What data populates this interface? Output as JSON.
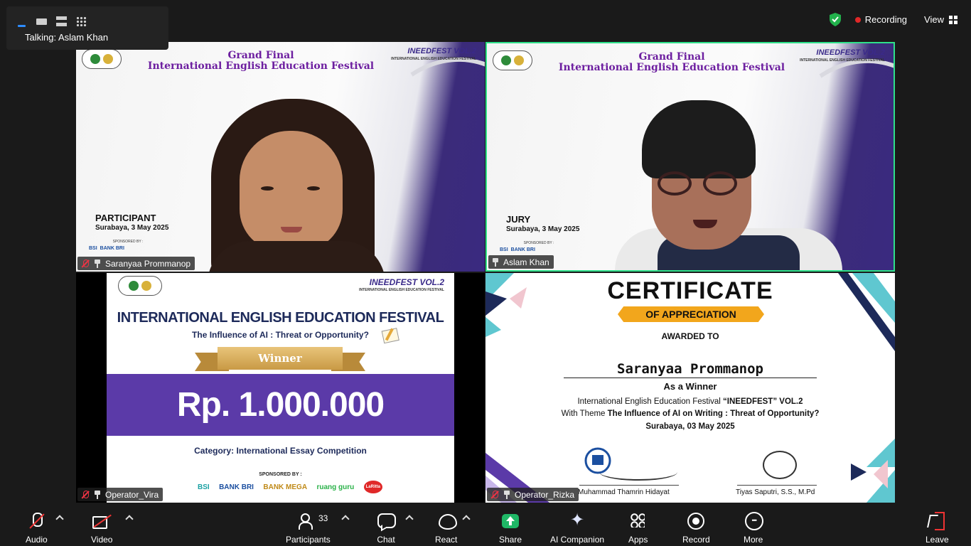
{
  "topbar": {
    "talking_label": "Talking: Aslam Khan",
    "recording_label": "Recording",
    "view_label": "View"
  },
  "tiles": [
    {
      "participant_name": "Saranyaa Prommanop",
      "title_line1": "Grand Final",
      "title_line2": "International English Education Festival",
      "event_logo": "INEEDFEST VOL.2",
      "event_logo_sub": "INTERNATIONAL ENGLISH EDUCATION FESTIVAL",
      "role": "PARTICIPANT",
      "date": "Surabaya, 3 May 2025",
      "sponsored_by": "SPONSORED BY :",
      "sponsors": [
        "BSI",
        "BANK BRI"
      ]
    },
    {
      "participant_name": "Aslam Khan",
      "title_line1": "Grand Final",
      "title_line2": "International English Education Festival",
      "event_logo": "INEEDFEST VOL.2",
      "event_logo_sub": "INTERNATIONAL ENGLISH EDUCATION FESTIVAL",
      "role": "JURY",
      "date": "Surabaya, 3 May 2025",
      "sponsored_by": "SPONSORED BY :",
      "sponsors": [
        "BSI",
        "BANK BRI"
      ]
    },
    {
      "participant_name": "Operator_Vira",
      "event_logo": "INEEDFEST VOL.2",
      "event_logo_sub": "INTERNATIONAL ENGLISH EDUCATION FESTIVAL",
      "poster_title": "INTERNATIONAL ENGLISH EDUCATION FESTIVAL",
      "poster_subtitle": "The Influence of AI : Threat or Opportunity?",
      "ribbon_label": "Winner",
      "prize_amount": "Rp. 1.000.000",
      "category": "Category: International Essay Competition",
      "sponsored_by": "SPONSORED BY :",
      "sponsors": [
        "BSI",
        "BANK BRI",
        "BANK MEGA",
        "ruang guru",
        "LaRitta"
      ]
    },
    {
      "participant_name": "Operator_Rizka",
      "cert_title": "CERTIFICATE",
      "cert_banner": "OF APPRECIATION",
      "awarded_to": "AWARDED TO",
      "recipient": "Saranyaa Prommanop",
      "as_winner": "As a Winner",
      "line1_pre": "International English Education Festival ",
      "line1_bold": "“INEEDFEST” VOL.2",
      "line2_pre": "With Theme ",
      "line2_bold": "The Influence of AI on Writing : Threat of Opportunity?",
      "date": "Surabaya, 03 May 2025",
      "signer1": "Muhammad Thamrin Hidayat",
      "signer2": "Tiyas Saputri, S.S., M.Pd"
    }
  ],
  "toolbar": {
    "audio": "Audio",
    "video": "Video",
    "participants": "Participants",
    "participants_count": "33",
    "chat": "Chat",
    "react": "React",
    "share": "Share",
    "ai_companion": "AI Companion",
    "apps": "Apps",
    "record": "Record",
    "more": "More",
    "leave": "Leave"
  },
  "colors": {
    "active_speaker_border": "#2ee08a",
    "share_green": "#1fb766",
    "recording_red": "#e02828",
    "fest_purple": "#6d1fa0",
    "prize_band": "#5b3aa8"
  }
}
